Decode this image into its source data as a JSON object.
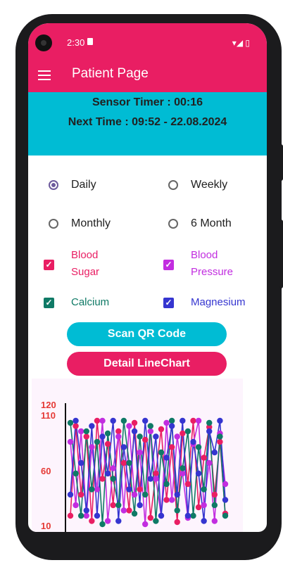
{
  "status_bar": {
    "time": "2:30"
  },
  "app_bar": {
    "title": "Patient Page"
  },
  "timer": {
    "sensor_timer": "Sensor Timer : 00:16",
    "next_time": "Next Time : 09:52 - 22.08.2024"
  },
  "period_options": [
    {
      "label": "Daily",
      "selected": true
    },
    {
      "label": "Weekly",
      "selected": false
    },
    {
      "label": "Monthly",
      "selected": false
    },
    {
      "label": "6 Month",
      "selected": false
    }
  ],
  "measurements": [
    {
      "line1": "Blood",
      "line2": "Sugar",
      "checked": true,
      "color": "#e91e63"
    },
    {
      "line1": "Blood",
      "line2": "Pressure",
      "checked": true,
      "color": "#c22de0"
    },
    {
      "line1": "Calcium",
      "line2": "",
      "checked": true,
      "color": "#0f7a66"
    },
    {
      "line1": "Magnesium",
      "line2": "",
      "checked": true,
      "color": "#3535d0"
    }
  ],
  "buttons": {
    "scan_qr": "Scan QR Code",
    "detail_linechart": "Detail LineChart"
  },
  "colors": {
    "primary": "#e91e63",
    "accent": "#00bcd4"
  },
  "chart_data": {
    "type": "line",
    "ytick_labels": [
      "120",
      "110",
      "60",
      "10"
    ],
    "ylim": [
      10,
      120
    ],
    "x": [
      1,
      2,
      3,
      4,
      5,
      6,
      7,
      8,
      9,
      10,
      11,
      12,
      13,
      14,
      15,
      16,
      17,
      18,
      19,
      20,
      21,
      22,
      23,
      24,
      25,
      26,
      27,
      28,
      29,
      30
    ],
    "series": [
      {
        "color": "#e91e63",
        "values": [
          20,
          105,
          40,
          95,
          15,
          110,
          55,
          88,
          30,
          100,
          70,
          25,
          108,
          45,
          92,
          18,
          60,
          102,
          35,
          85,
          14,
          98,
          50,
          110,
          28,
          75,
          104,
          40,
          90,
          22
        ]
      },
      {
        "color": "#c22de0",
        "values": [
          90,
          30,
          100,
          20,
          85,
          45,
          110,
          15,
          65,
          95,
          25,
          105,
          40,
          80,
          12,
          100,
          55,
          20,
          108,
          35,
          95,
          60,
          18,
          88,
          110,
          30,
          70,
          15,
          98,
          50
        ]
      },
      {
        "color": "#0f7a66",
        "values": [
          108,
          60,
          20,
          100,
          45,
          90,
          12,
          98,
          55,
          30,
          110,
          70,
          22,
          95,
          40,
          105,
          15,
          80,
          50,
          110,
          25,
          65,
          100,
          20,
          85,
          45,
          108,
          30,
          95,
          20
        ]
      },
      {
        "color": "#3535d0",
        "values": [
          40,
          110,
          70,
          25,
          105,
          20,
          95,
          60,
          110,
          15,
          85,
          45,
          100,
          30,
          110,
          55,
          95,
          20,
          75,
          105,
          40,
          110,
          20,
          90,
          60,
          15,
          100,
          80,
          110,
          35
        ]
      }
    ]
  }
}
